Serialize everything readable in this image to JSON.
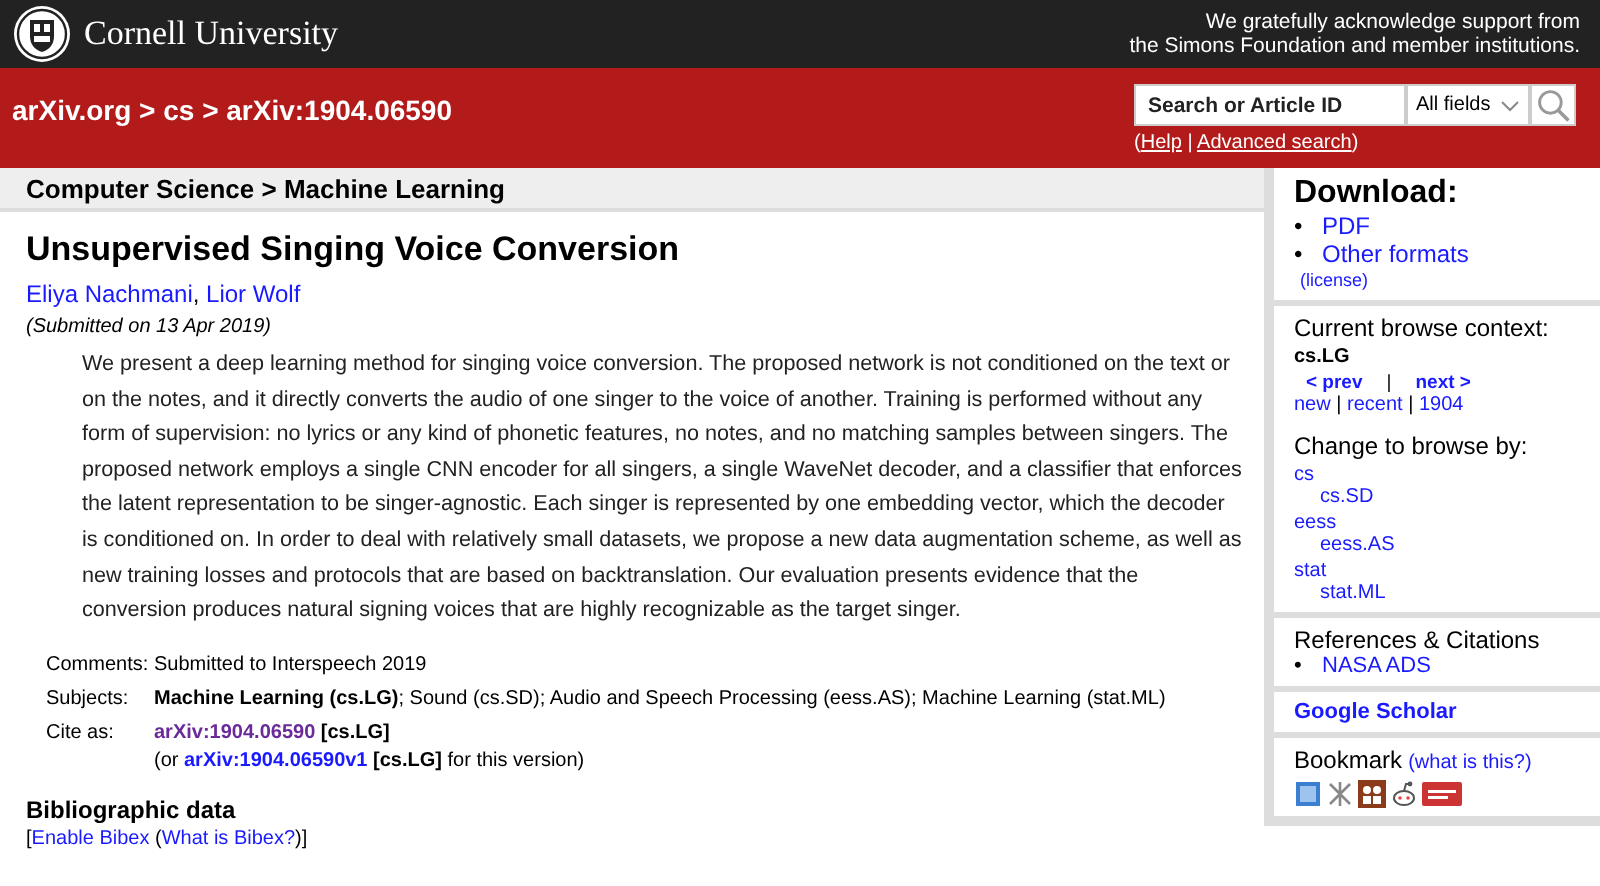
{
  "header": {
    "university": "Cornell University",
    "acknowledgement": [
      "We gratefully acknowledge support from",
      "the Simons Foundation and member institutions."
    ]
  },
  "nav": {
    "breadcrumb": "arXiv.org > cs > arXiv:1904.06590",
    "search": {
      "placeholder": "Search or Article ID",
      "field": "All fields"
    },
    "help": [
      {
        "kind": "text",
        "text": "("
      },
      {
        "kind": "link",
        "text": "Help"
      },
      {
        "kind": "text",
        "text": " | "
      },
      {
        "kind": "link",
        "text": "Advanced search"
      },
      {
        "kind": "text",
        "text": ")"
      }
    ]
  },
  "subheader": "Computer Science > Machine Learning",
  "paper": {
    "title": "Unsupervised Singing Voice Conversion",
    "authors": [
      {
        "kind": "link",
        "text": "Eliya Nachmani"
      },
      {
        "kind": "text",
        "text": ", "
      },
      {
        "kind": "link",
        "text": "Lior Wolf"
      }
    ],
    "submitted": "(Submitted on 13 Apr 2019)",
    "abstract": "We present a deep learning method for singing voice conversion. The proposed network is not conditioned on the text or on the notes, and it directly converts the audio of one singer to the voice of another. Training is performed without any form of supervision: no lyrics or any kind of phonetic features, no notes, and no matching samples between singers. The proposed network employs a single CNN encoder for all singers, a single WaveNet decoder, and a classifier that enforces the latent representation to be singer-agnostic. Each singer is represented by one embedding vector, which the decoder is conditioned on. In order to deal with relatively small datasets, we propose a new data augmentation scheme, as well as new training losses and protocols that are based on backtranslation. Our evaluation presents evidence that the conversion produces natural signing voices that are highly recognizable as the target singer.",
    "metadata": [
      {
        "label": "Comments:",
        "lines": [
          [
            {
              "kind": "text",
              "text": "Submitted to Interspeech 2019"
            }
          ]
        ]
      },
      {
        "label": "Subjects:",
        "lines": [
          [
            {
              "kind": "rich",
              "text": "**Machine Learning (cs.LG)**; Sound (cs.SD); Audio and Speech Processing (eess.AS); Machine Learning (stat.ML)"
            }
          ]
        ]
      },
      {
        "label": "Cite as:",
        "lines": [
          [
            {
              "kind": "visited",
              "text": "arXiv:1904.06590"
            },
            {
              "kind": "bold",
              "text": " [cs.LG]"
            }
          ],
          [
            {
              "kind": "text",
              "text": "(or "
            },
            {
              "kind": "boldlink",
              "text": "arXiv:1904.06590v1"
            },
            {
              "kind": "bold",
              "text": " [cs.LG]"
            },
            {
              "kind": "text",
              "text": " for this version)"
            }
          ]
        ]
      }
    ],
    "bibliographic": {
      "heading": "Bibliographic data",
      "links": [
        {
          "kind": "text",
          "text": "["
        },
        {
          "kind": "link",
          "text": "Enable Bibex"
        },
        {
          "kind": "text",
          "text": " ("
        },
        {
          "kind": "link",
          "text": "What is Bibex?"
        },
        {
          "kind": "text",
          "text": ")]"
        }
      ]
    }
  },
  "sidebar": {
    "download": {
      "heading": "Download:",
      "bullet": "•",
      "formats": [
        "PDF",
        "Other formats"
      ],
      "license": "(license)"
    },
    "browse": {
      "heading": "Current browse context:",
      "context": "cs.LG",
      "pager": [
        {
          "kind": "boldlink",
          "text": "< prev"
        },
        {
          "kind": "text",
          "text": "|"
        },
        {
          "kind": "boldlink",
          "text": "next >"
        }
      ],
      "lists": [
        {
          "kind": "link",
          "text": "new"
        },
        {
          "kind": "text",
          "text": " | "
        },
        {
          "kind": "link",
          "text": "recent"
        },
        {
          "kind": "text",
          "text": " | "
        },
        {
          "kind": "link",
          "text": "1904"
        }
      ]
    },
    "change": {
      "heading": "Change to browse by:",
      "archives": [
        {
          "name": "cs",
          "children": [
            "cs.SD"
          ]
        },
        {
          "name": "eess",
          "children": [
            "eess.AS"
          ]
        },
        {
          "name": "stat",
          "children": [
            "stat.ML"
          ]
        }
      ]
    },
    "references": {
      "heading": "References & Citations",
      "bullet": "•",
      "links": [
        "NASA ADS"
      ]
    },
    "scholar": "Google Scholar",
    "bookmark": {
      "heading": "Bookmark",
      "help": "(what is this?)"
    }
  }
}
